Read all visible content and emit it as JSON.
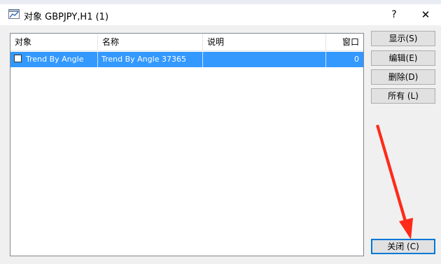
{
  "window": {
    "title": "对象 GBPJPY,H1 (1)",
    "help_glyph": "?",
    "close_glyph": "✕"
  },
  "list": {
    "columns": [
      "对象",
      "名称",
      "说明",
      "窗口"
    ],
    "rows": [
      {
        "object": "Trend By Angle",
        "name": "Trend By Angle 37365",
        "description": "",
        "window": "0",
        "selected": true,
        "checked": false
      }
    ]
  },
  "buttons": {
    "show": "显示(S)",
    "edit": "编辑(E)",
    "delete": "删除(D)",
    "all": "所有 (L)",
    "close": "关闭 (C)"
  },
  "colors": {
    "selection": "#3399ff",
    "annotation_arrow": "#ff2a1a",
    "default_button_border": "#0078d7"
  },
  "icons": {
    "title": "chart-window-icon"
  }
}
